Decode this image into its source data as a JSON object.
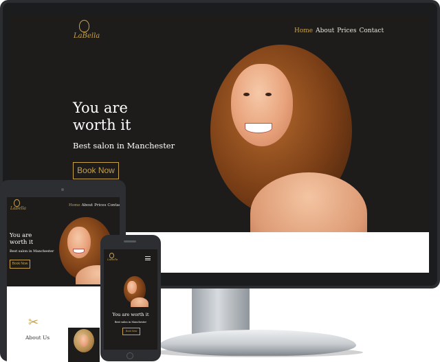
{
  "brand": {
    "name": "LaBella",
    "accent": "#c9a24a"
  },
  "nav": {
    "items": [
      "Home",
      "About",
      "Prices",
      "Contact"
    ],
    "active": "Home"
  },
  "hero": {
    "title": "You are\nworth it",
    "title_single": "You are worth it",
    "subtitle": "Best salon in Manchester",
    "cta": "Book Now"
  },
  "tablet": {
    "about_heading": "About Us"
  },
  "phone": {
    "subtitle": "Best salon in Manchester",
    "cta": "Book Now"
  }
}
